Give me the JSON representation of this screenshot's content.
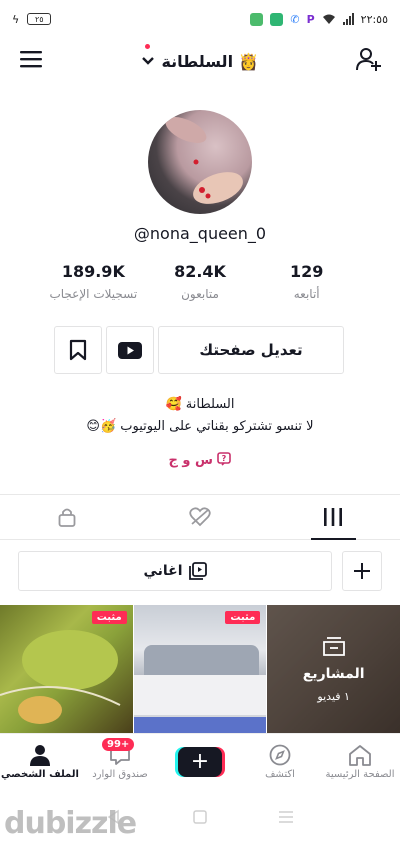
{
  "status_bar": {
    "time": "٢٢:٥٥",
    "battery": "٢٥"
  },
  "header": {
    "display_name": "السلطانة 👸"
  },
  "profile": {
    "username": "@nona_queen_0",
    "stats": [
      {
        "value": "189.9K",
        "label": "تسجيلات الإعجاب"
      },
      {
        "value": "82.4K",
        "label": "متابعون"
      },
      {
        "value": "129",
        "label": "أتابعه"
      }
    ],
    "edit_label": "تعديل صفحتك",
    "bio_line1": "السلطانة 🥰",
    "bio_line2": "لا تنسو تشتركو بقناتي على اليوتيوب 🥳😊",
    "link_text": "س و ج"
  },
  "playlist": {
    "label": "اغاني"
  },
  "grid": {
    "pinned_label": "مثبت",
    "projects_title": "المشاريع",
    "projects_count": "١ فيديو"
  },
  "bottom_nav": {
    "items": [
      {
        "label": "الصفحة الرئيسية",
        "icon": "home-icon"
      },
      {
        "label": "اكتشف",
        "icon": "compass-icon"
      },
      {
        "label": "",
        "icon": "plus-icon"
      },
      {
        "label": "صندوق الوارد",
        "icon": "inbox-icon"
      },
      {
        "label": "الملف الشخصي",
        "icon": "profile-icon"
      }
    ],
    "badge": "99+"
  },
  "watermark": "dubizzle",
  "colors": {
    "accent": "#fe2c55",
    "link": "#c9306b",
    "cyan": "#25f4ee"
  }
}
